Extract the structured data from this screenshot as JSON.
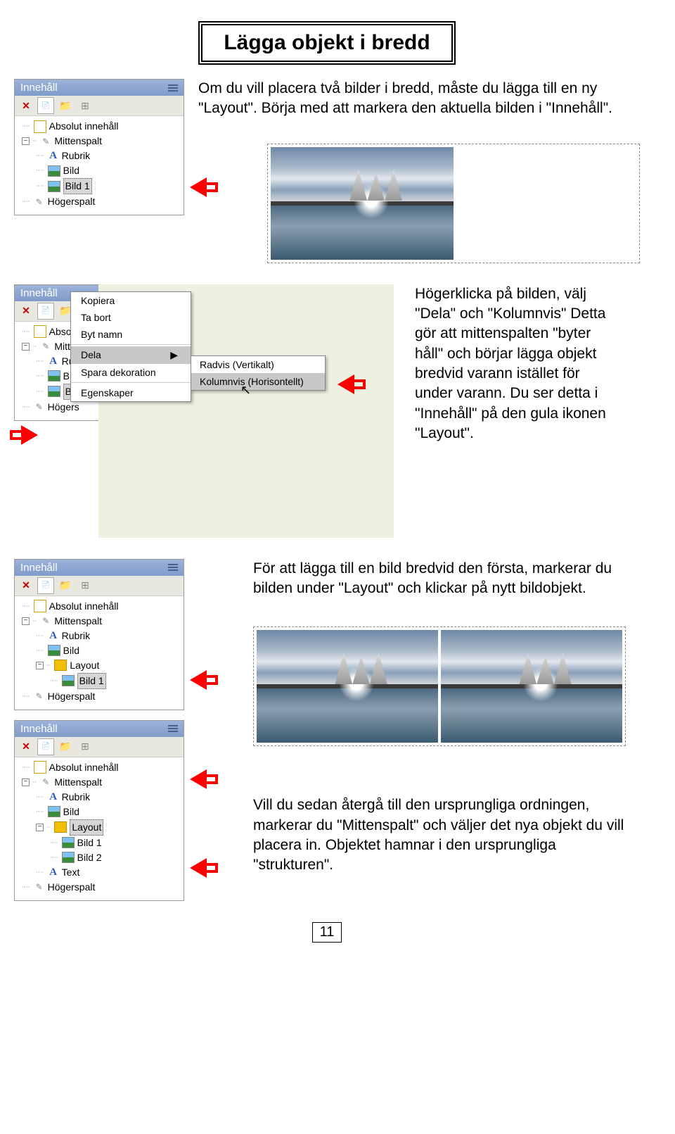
{
  "title": "Lägga objekt i bredd",
  "intro": "Om du vill placera två bilder i bredd, måste du lägga till en ny \"Layout\". Börja med att markera den aktuella bilden i \"Innehåll\".",
  "panel": {
    "header": "Innehåll"
  },
  "tree": {
    "absolut": "Absolut innehåll",
    "mittenspalt": "Mittenspalt",
    "rubrik": "Rubrik",
    "bild": "Bild",
    "bild1": "Bild 1",
    "bild2": "Bild 2",
    "bild_short": "Bild",
    "layout": "Layout",
    "text": "Text",
    "hogers": "Högers",
    "hogerspalt": "Högerspalt"
  },
  "ctx": {
    "kopiera": "Kopiera",
    "tabort": "Ta bort",
    "bytnamn": "Byt namn",
    "dela": "Dela",
    "spara": "Spara dekoration",
    "egenskaper": "Egenskaper",
    "arrow": "▶"
  },
  "submenu": {
    "radvis": "Radvis (Vertikalt)",
    "kolumnvis": "Kolumnvis (Horisontellt)"
  },
  "para2": "Högerklicka på bilden, välj \"Dela\" och \"Kolumnvis\" Detta gör att mittenspalten \"byter håll\" och börjar lägga objekt bredvid varann istället för under varann. Du ser detta i \"Innehåll\" på den gula ikonen \"Layout\".",
  "para3": "För att lägga till en bild bredvid den första, markerar du bilden under \"Layout\" och klickar på nytt bildobjekt.",
  "para4": "Vill du sedan återgå till den ursprungliga ordningen, markerar du \"Mittenspalt\" och väljer det nya objekt du vill placera in. Objektet hamnar i den ursprungliga \"strukturen\".",
  "page_number": "11"
}
